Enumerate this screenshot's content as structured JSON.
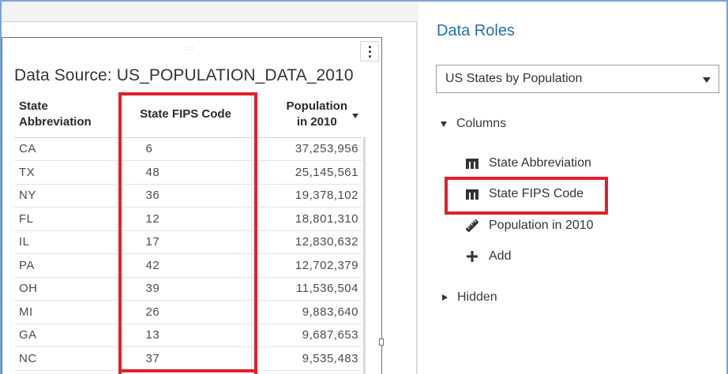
{
  "report": {
    "data_source_title": "Data Source: US_POPULATION_DATA_2010",
    "grip_glyph": "::::",
    "columns": [
      {
        "line1": "State",
        "line2": "Abbreviation"
      },
      {
        "line1": "State FIPS Code",
        "line2": ""
      },
      {
        "line1": "Population",
        "line2": "in 2010"
      }
    ],
    "rows": [
      {
        "abbr": "CA",
        "fips": "6",
        "pop": "37,253,956"
      },
      {
        "abbr": "TX",
        "fips": "48",
        "pop": "25,145,561"
      },
      {
        "abbr": "NY",
        "fips": "36",
        "pop": "19,378,102"
      },
      {
        "abbr": "FL",
        "fips": "12",
        "pop": "18,801,310"
      },
      {
        "abbr": "IL",
        "fips": "17",
        "pop": "12,830,632"
      },
      {
        "abbr": "PA",
        "fips": "42",
        "pop": "12,702,379"
      },
      {
        "abbr": "OH",
        "fips": "39",
        "pop": "11,536,504"
      },
      {
        "abbr": "MI",
        "fips": "26",
        "pop": "9,883,640"
      },
      {
        "abbr": "GA",
        "fips": "13",
        "pop": "9,687,653"
      },
      {
        "abbr": "NC",
        "fips": "37",
        "pop": "9,535,483"
      }
    ]
  },
  "panel": {
    "title": "Data Roles",
    "dropdown_value": "US States by Population",
    "columns_label": "Columns",
    "items": [
      {
        "label": "State Abbreviation",
        "icon": "category-icon"
      },
      {
        "label": "State FIPS Code",
        "icon": "category-icon"
      },
      {
        "label": "Population in 2010",
        "icon": "measure-icon"
      },
      {
        "label": "Add",
        "icon": "plus-icon"
      }
    ],
    "hidden_label": "Hidden"
  },
  "colors": {
    "accent": "#1f6fb5",
    "highlight": "#e0202a",
    "frame": "#7aa3d6"
  }
}
